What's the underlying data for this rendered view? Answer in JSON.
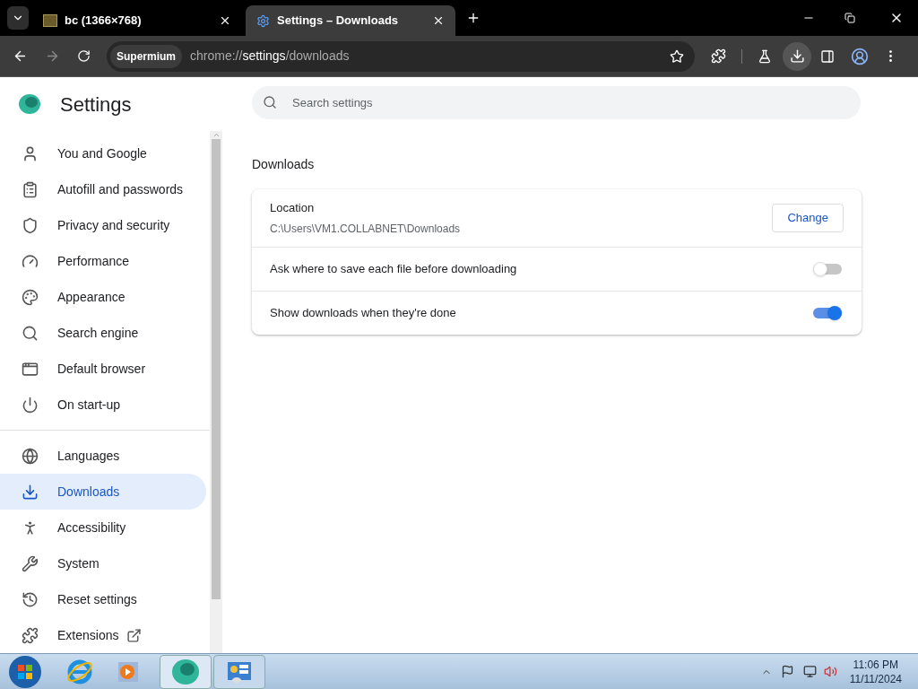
{
  "tabs": [
    {
      "title": "bc (1366×768)",
      "selected": false
    },
    {
      "title": "Settings – Downloads",
      "selected": true
    }
  ],
  "toolbar": {
    "brand": "Supermium",
    "url_host": "chrome://",
    "url_path": "settings",
    "url_rest": "/downloads"
  },
  "sidebar": {
    "title": "Settings",
    "items": [
      {
        "label": "You and Google",
        "selected": false
      },
      {
        "label": "Autofill and passwords",
        "selected": false
      },
      {
        "label": "Privacy and security",
        "selected": false
      },
      {
        "label": "Performance",
        "selected": false
      },
      {
        "label": "Appearance",
        "selected": false
      },
      {
        "label": "Search engine",
        "selected": false
      },
      {
        "label": "Default browser",
        "selected": false
      },
      {
        "label": "On start-up",
        "selected": false
      },
      {
        "label": "Languages",
        "selected": false
      },
      {
        "label": "Downloads",
        "selected": true
      },
      {
        "label": "Accessibility",
        "selected": false
      },
      {
        "label": "System",
        "selected": false
      },
      {
        "label": "Reset settings",
        "selected": false
      },
      {
        "label": "Extensions",
        "selected": false
      }
    ]
  },
  "search": {
    "placeholder": "Search settings"
  },
  "section": {
    "title": "Downloads",
    "location": {
      "label": "Location",
      "path": "C:\\Users\\VM1.COLLABNET\\Downloads",
      "button": "Change"
    },
    "toggles": [
      {
        "label": "Ask where to save each file before downloading",
        "on": false
      },
      {
        "label": "Show downloads when they're done",
        "on": true
      }
    ]
  },
  "taskbar": {
    "clock_time": "11:06 PM",
    "clock_date": "11/11/2024"
  }
}
